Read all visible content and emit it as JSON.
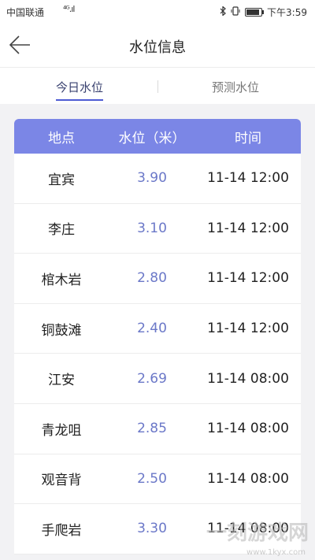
{
  "status_bar": {
    "carrier": "中国联通",
    "signal": "⁴ᴳ.ıl",
    "time": "下午3:59",
    "battery_level": 0.9
  },
  "nav": {
    "title": "水位信息"
  },
  "tabs": [
    {
      "label": "今日水位",
      "active": true
    },
    {
      "label": "预测水位",
      "active": false
    }
  ],
  "table": {
    "headers": [
      "地点",
      "水位（米）",
      "时间"
    ],
    "rows": [
      {
        "location": "宜宾",
        "level": "3.90",
        "time": "11-14 12:00"
      },
      {
        "location": "李庄",
        "level": "3.10",
        "time": "11-14 12:00"
      },
      {
        "location": "棺木岩",
        "level": "2.80",
        "time": "11-14 12:00"
      },
      {
        "location": "铜鼓滩",
        "level": "2.40",
        "time": "11-14 12:00"
      },
      {
        "location": "江安",
        "level": "2.69",
        "time": "11-14 08:00"
      },
      {
        "location": "青龙咀",
        "level": "2.85",
        "time": "11-14 08:00"
      },
      {
        "location": "观音背",
        "level": "2.50",
        "time": "11-14 08:00"
      },
      {
        "location": "手爬岩",
        "level": "3.30",
        "time": "11-14 08:00"
      }
    ]
  },
  "watermark": {
    "text": "一刻游戏网",
    "url": "www.1kyx.com"
  },
  "colors": {
    "header_bg": "#7b86e6",
    "level_text": "#6b78c8",
    "tab_active": "#4d5bd3"
  }
}
